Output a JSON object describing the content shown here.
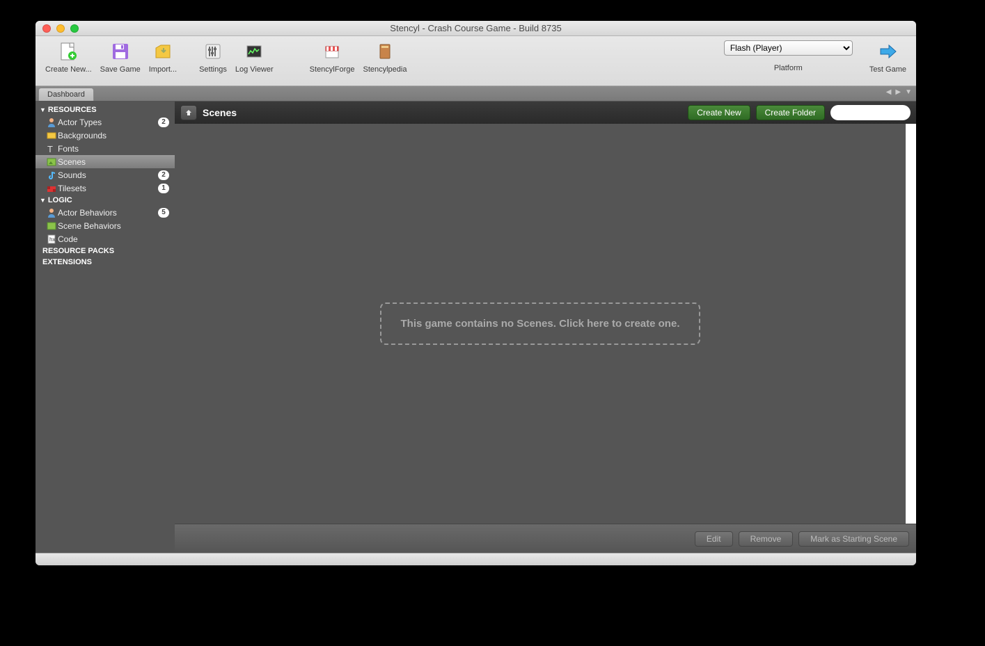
{
  "window": {
    "title": "Stencyl - Crash Course Game - Build 8735"
  },
  "toolbar": {
    "create_new": "Create New...",
    "save_game": "Save Game",
    "import": "Import...",
    "settings": "Settings",
    "log_viewer": "Log Viewer",
    "stencylforge": "StencylForge",
    "stencylpedia": "Stencylpedia",
    "platform_label": "Platform",
    "platform_value": "Flash (Player)",
    "test_game": "Test Game"
  },
  "tabs": {
    "dashboard": "Dashboard"
  },
  "sidebar": {
    "resources_header": "RESOURCES",
    "logic_header": "LOGIC",
    "resource_packs": "RESOURCE PACKS",
    "extensions": "EXTENSIONS",
    "items": {
      "actor_types": {
        "label": "Actor Types",
        "count": "2"
      },
      "backgrounds": {
        "label": "Backgrounds"
      },
      "fonts": {
        "label": "Fonts"
      },
      "scenes": {
        "label": "Scenes"
      },
      "sounds": {
        "label": "Sounds",
        "count": "2"
      },
      "tilesets": {
        "label": "Tilesets",
        "count": "1"
      },
      "actor_behaviors": {
        "label": "Actor Behaviors",
        "count": "5"
      },
      "scene_behaviors": {
        "label": "Scene Behaviors"
      },
      "code": {
        "label": "Code"
      }
    }
  },
  "main": {
    "title": "Scenes",
    "create_new_btn": "Create New",
    "create_folder_btn": "Create Folder",
    "search_placeholder": "",
    "empty_message": "This game contains no Scenes. Click here to create one.",
    "footer": {
      "edit": "Edit",
      "remove": "Remove",
      "mark_starting": "Mark as Starting Scene"
    }
  }
}
